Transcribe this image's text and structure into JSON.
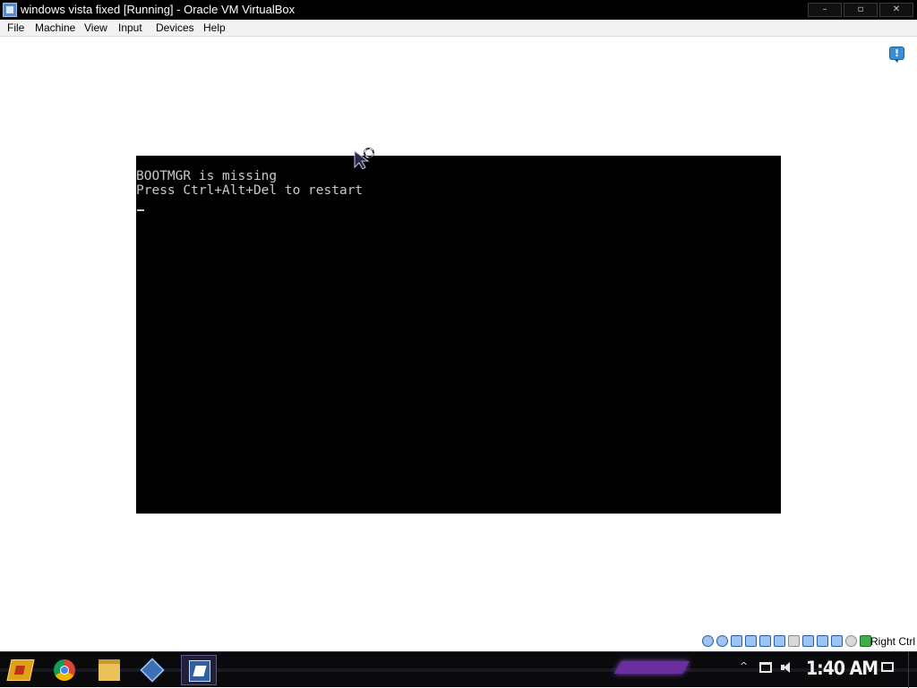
{
  "window": {
    "title": "windows vista fixed [Running] - Oracle VM VirtualBox",
    "controls": {
      "minimize": "–",
      "restore": "▫",
      "close": "✕"
    }
  },
  "menu": {
    "items": [
      "File",
      "Machine",
      "View",
      "Input",
      "Devices",
      "Help"
    ]
  },
  "guest": {
    "console_lines": [
      "BOOTMGR is missing",
      "Press Ctrl+Alt+Del to restart"
    ],
    "background": "#000000",
    "text_color": "#c8c8c8"
  },
  "notification": {
    "glyph": "!",
    "icon": "info-notification-icon"
  },
  "statusbar": {
    "icons": [
      "hard-disk-icon",
      "optical-drive-icon",
      "floppy-icon",
      "audio-icon",
      "network-icon",
      "usb-icon",
      "shared-folders-icon",
      "display-icon",
      "video-capture-icon",
      "virtualization-icon",
      "mouse-integration-icon",
      "keyboard-icon"
    ],
    "host_key": "Right Ctrl"
  },
  "taskbar": {
    "apps": [
      "start-button",
      "chrome-icon",
      "file-explorer-icon",
      "virtualbox-icon",
      "windows-vista-vm-icon"
    ],
    "tray_arrow": "^",
    "clock": "1:40 AM",
    "accent_color": "#6a2ea0"
  }
}
